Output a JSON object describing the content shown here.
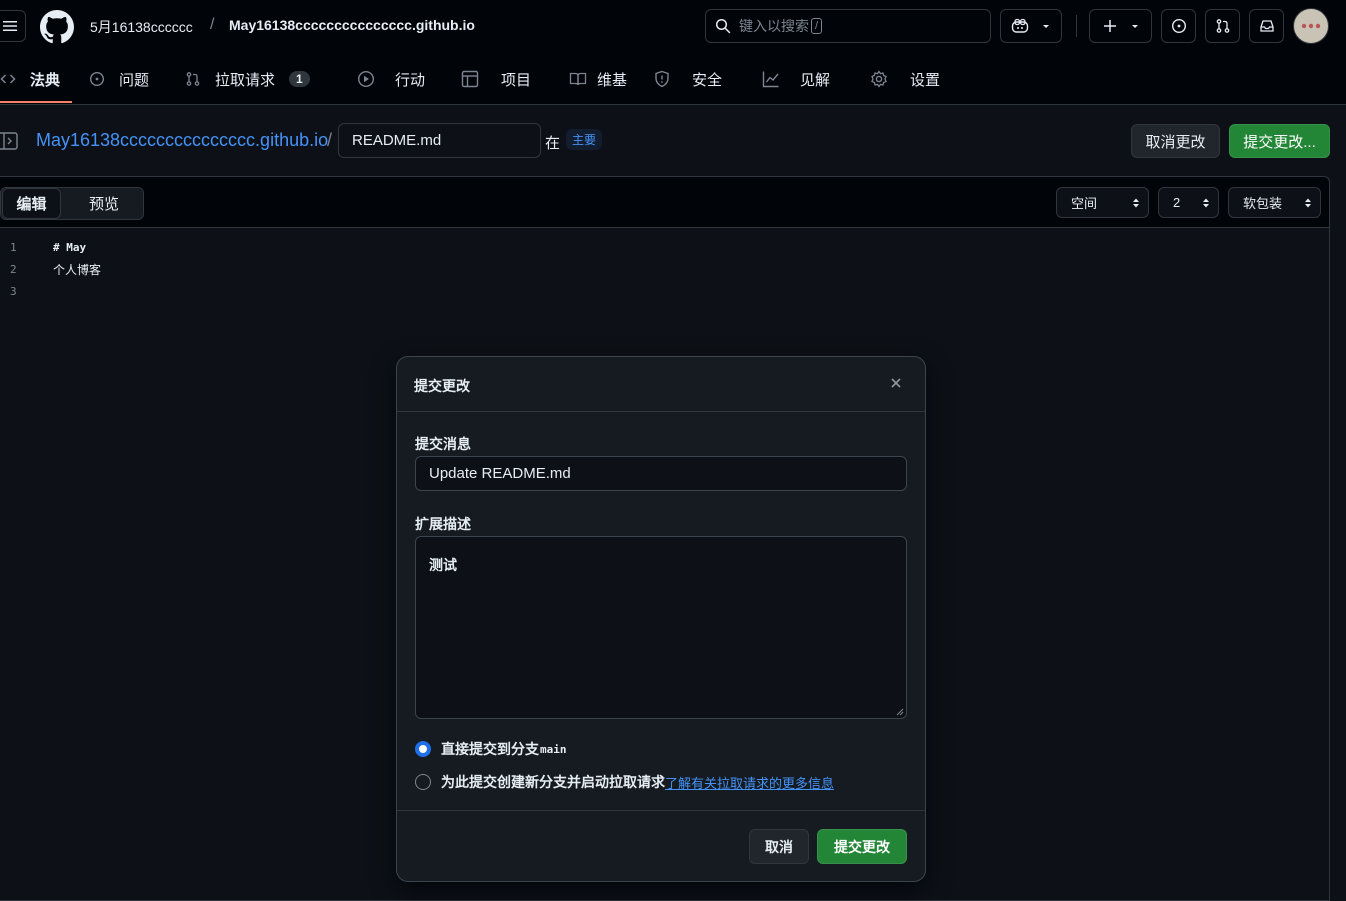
{
  "header": {
    "owner": "5月16138cccccc",
    "separator": "/",
    "repo": "May16138ccccccccccccccc.github.io",
    "search_placeholder": "键入以搜索",
    "search_shortcut": "/"
  },
  "repo_tabs": [
    {
      "label": "法典",
      "icon": "code-icon",
      "active": true
    },
    {
      "label": "问题",
      "icon": "issue-icon"
    },
    {
      "label": "拉取请求",
      "icon": "pull-request-icon",
      "count": "1"
    },
    {
      "label": "行动",
      "icon": "play-icon"
    },
    {
      "label": "项目",
      "icon": "table-icon"
    },
    {
      "label": "维基",
      "icon": "book-icon"
    },
    {
      "label": "安全",
      "icon": "shield-icon"
    },
    {
      "label": "见解",
      "icon": "graph-icon"
    },
    {
      "label": "设置",
      "icon": "gear-icon"
    }
  ],
  "file_bar": {
    "repo_link": "May16138ccccccccccccccc.github.io",
    "separator": "/",
    "filename": "README.md",
    "in_label": "在",
    "branch": "主要",
    "cancel_label": "取消更改",
    "commit_label": "提交更改..."
  },
  "editor": {
    "tabs": {
      "edit": "编辑",
      "preview": "预览"
    },
    "indent_mode": "空间",
    "indent_size": "2",
    "wrap_mode": "软包装",
    "lines": [
      {
        "n": "1",
        "text": "# May"
      },
      {
        "n": "2",
        "text": "个人博客"
      },
      {
        "n": "3",
        "text": ""
      }
    ]
  },
  "modal": {
    "title": "提交更改",
    "message_label": "提交消息",
    "message_value": "Update README.md",
    "description_label": "扩展描述",
    "description_value": "测试",
    "option_direct": "直接提交到分支",
    "option_direct_branch": "main",
    "option_new_branch": "为此提交创建新分支并启动拉取请求",
    "learn_more": "了解有关拉取请求的更多信息",
    "cancel_label": "取消",
    "submit_label": "提交更改"
  },
  "colors": {
    "background": "#0d1117",
    "header": "#010409",
    "accent_blue": "#4493f8",
    "primary_green": "#238636",
    "tab_underline": "#f78166"
  }
}
